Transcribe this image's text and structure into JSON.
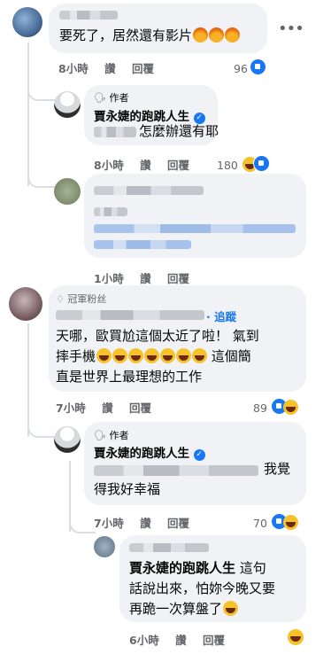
{
  "comments": [
    {
      "text": "要死了，居然還有影片",
      "time": "8小時",
      "like_label": "讚",
      "reply_label": "回覆",
      "reaction_count": "96",
      "more_icon": "ellipsis-icon"
    },
    {
      "author_tag": "作者",
      "author": "賈永婕的跑跳人生",
      "text": "怎麼辦還有耶",
      "time": "8小時",
      "like_label": "讚",
      "reply_label": "回覆",
      "reaction_count": "180"
    },
    {
      "time": "1小時",
      "like_label": "讚",
      "reply_label": "回覆"
    },
    {
      "fan_badge": "冠軍粉丝",
      "follow_label": "· 追蹤",
      "text_line1": "天哪，歐買尬這個太近了啦！ 氣到",
      "text_line2": "摔手機",
      "text_line2b": " 這個簡",
      "text_line3": "直是世界上最理想的工作",
      "time": "7小時",
      "like_label": "讚",
      "reply_label": "回覆",
      "reaction_count": "89"
    },
    {
      "author_tag": "作者",
      "author": "賈永婕的跑跳人生",
      "text_line1": "我覺",
      "text_line2": "得我好幸福",
      "time": "7小時",
      "like_label": "讚",
      "reply_label": "回覆",
      "reaction_count": "70"
    },
    {
      "mention": "賈永婕的跑跳人生",
      "text_line1": " 這句",
      "text_line2": "話說出來，怕妳今晚又要",
      "text_line3": "再跪一次算盤了",
      "time": "6小時",
      "like_label": "讚",
      "reply_label": "回覆"
    }
  ],
  "colors": {
    "bubble": "#f0f2f5",
    "meta": "#65676b",
    "link": "#1877f2"
  }
}
